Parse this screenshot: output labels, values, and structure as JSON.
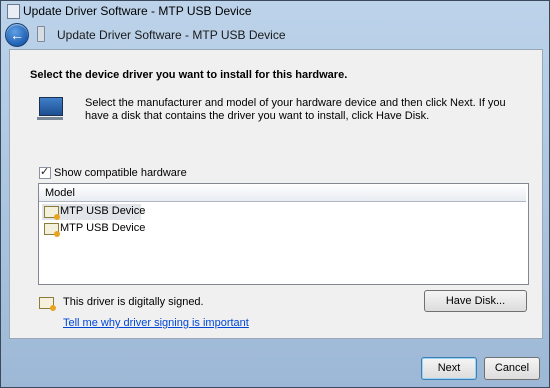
{
  "window": {
    "title": "Update Driver Software - MTP USB Device"
  },
  "nav": {
    "title": "Update Driver Software - MTP USB Device"
  },
  "content": {
    "heading": "Select the device driver you want to install for this hardware.",
    "description": "Select the manufacturer and model of your hardware device and then click Next. If you have a disk that contains the driver you want to install, click Have Disk.",
    "show_compatible": {
      "label": "Show compatible hardware",
      "checked": true
    },
    "list": {
      "column": "Model",
      "rows": [
        {
          "label": "MTP USB Device",
          "selected": true
        },
        {
          "label": "MTP USB Device",
          "selected": false
        }
      ]
    },
    "signed_text": "This driver is digitally signed.",
    "signing_link": "Tell me why driver signing is important",
    "have_disk": "Have Disk..."
  },
  "footer": {
    "next": "Next",
    "cancel": "Cancel"
  },
  "icons": {
    "back": "back-arrow-icon",
    "device": "usb-device-icon",
    "hardware": "hardware-monitor-icon",
    "driver": "driver-certificate-icon"
  }
}
